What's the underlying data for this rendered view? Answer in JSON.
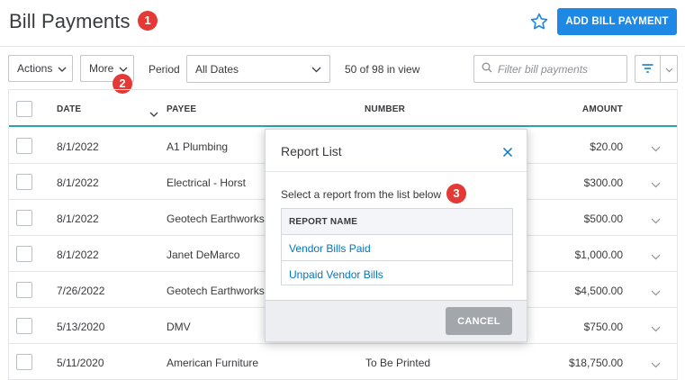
{
  "header": {
    "title": "Bill Payments",
    "badge": "1",
    "favorite_icon": "star-outline-icon",
    "add_button": "ADD BILL PAYMENT"
  },
  "toolbar": {
    "actions_label": "Actions",
    "more_label": "More",
    "more_badge": "2",
    "period_label": "Period",
    "period_value": "All Dates",
    "in_view": "50 of 98 in view",
    "filter_placeholder": "Filter bill payments"
  },
  "table": {
    "columns": {
      "date": "DATE",
      "payee": "PAYEE",
      "number": "NUMBER",
      "amount": "AMOUNT"
    },
    "rows": [
      {
        "date": "8/1/2022",
        "payee": "A1 Plumbing",
        "number": "",
        "amount": "$20.00"
      },
      {
        "date": "8/1/2022",
        "payee": "Electrical - Horst",
        "number": "",
        "amount": "$300.00"
      },
      {
        "date": "8/1/2022",
        "payee": "Geotech Earthworks",
        "number": "",
        "amount": "$500.00"
      },
      {
        "date": "8/1/2022",
        "payee": "Janet DeMarco",
        "number": "",
        "amount": "$1,000.00"
      },
      {
        "date": "7/26/2022",
        "payee": "Geotech Earthworks",
        "number": "",
        "amount": "$4,500.00"
      },
      {
        "date": "5/13/2020",
        "payee": "DMV",
        "number": "",
        "amount": "$750.00"
      },
      {
        "date": "5/11/2020",
        "payee": "American Furniture",
        "number": "To Be Printed",
        "amount": "$18,750.00"
      }
    ]
  },
  "modal": {
    "title": "Report List",
    "subtitle": "Select a report from the list below",
    "badge": "3",
    "column_header": "REPORT NAME",
    "reports": [
      "Vendor Bills Paid",
      "Unpaid Vendor Bills"
    ],
    "cancel_label": "CANCEL"
  },
  "colors": {
    "primary": "#1e88e5",
    "accent_teal": "#2ca4ad",
    "link": "#0077c5",
    "badge_red": "#e53935"
  }
}
